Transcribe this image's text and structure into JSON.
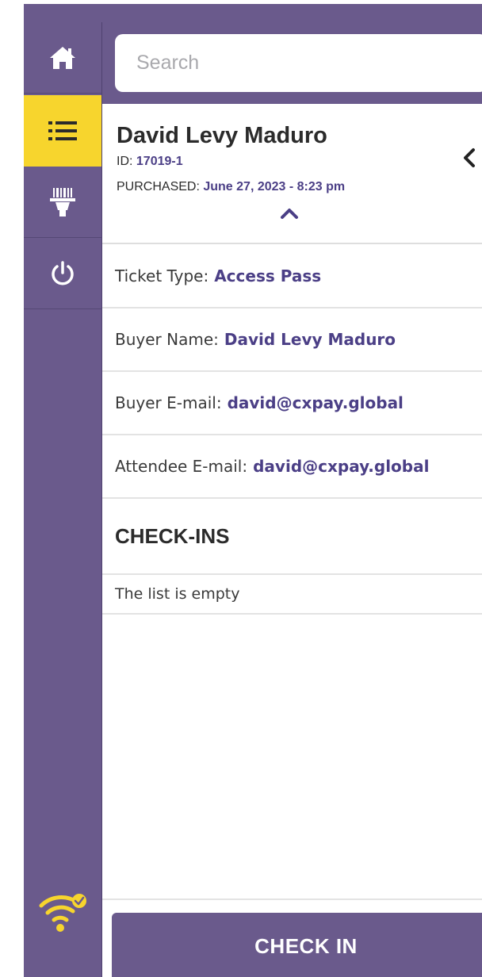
{
  "search": {
    "placeholder": "Search"
  },
  "sidebar": {
    "items": [
      {
        "name": "home",
        "icon": "home-icon",
        "active": false
      },
      {
        "name": "list",
        "icon": "list-icon",
        "active": true
      },
      {
        "name": "scan",
        "icon": "barcode-scanner-icon",
        "active": false
      },
      {
        "name": "logout",
        "icon": "power-icon",
        "active": false
      }
    ],
    "status_icon": "wifi-connected-icon"
  },
  "attendee": {
    "name": "David Levy Maduro",
    "id_label": "ID:",
    "id_value": "17019-1",
    "purchased_label": "PURCHASED:",
    "purchased_value": "June 27, 2023 - 8:23 pm"
  },
  "details": [
    {
      "label": "Ticket Type:",
      "value": "Access Pass"
    },
    {
      "label": "Buyer Name:",
      "value": "David Levy Maduro"
    },
    {
      "label": "Buyer E-mail:",
      "value": "david@cxpay.global"
    },
    {
      "label": "Attendee E-mail:",
      "value": "david@cxpay.global"
    }
  ],
  "checkins": {
    "heading": "CHECK-INS",
    "empty_text": "The list is empty"
  },
  "actions": {
    "check_in_label": "CHECK IN"
  },
  "colors": {
    "primary": "#6a5a8c",
    "accent": "#f7d52d",
    "value_text": "#4b3f86"
  }
}
